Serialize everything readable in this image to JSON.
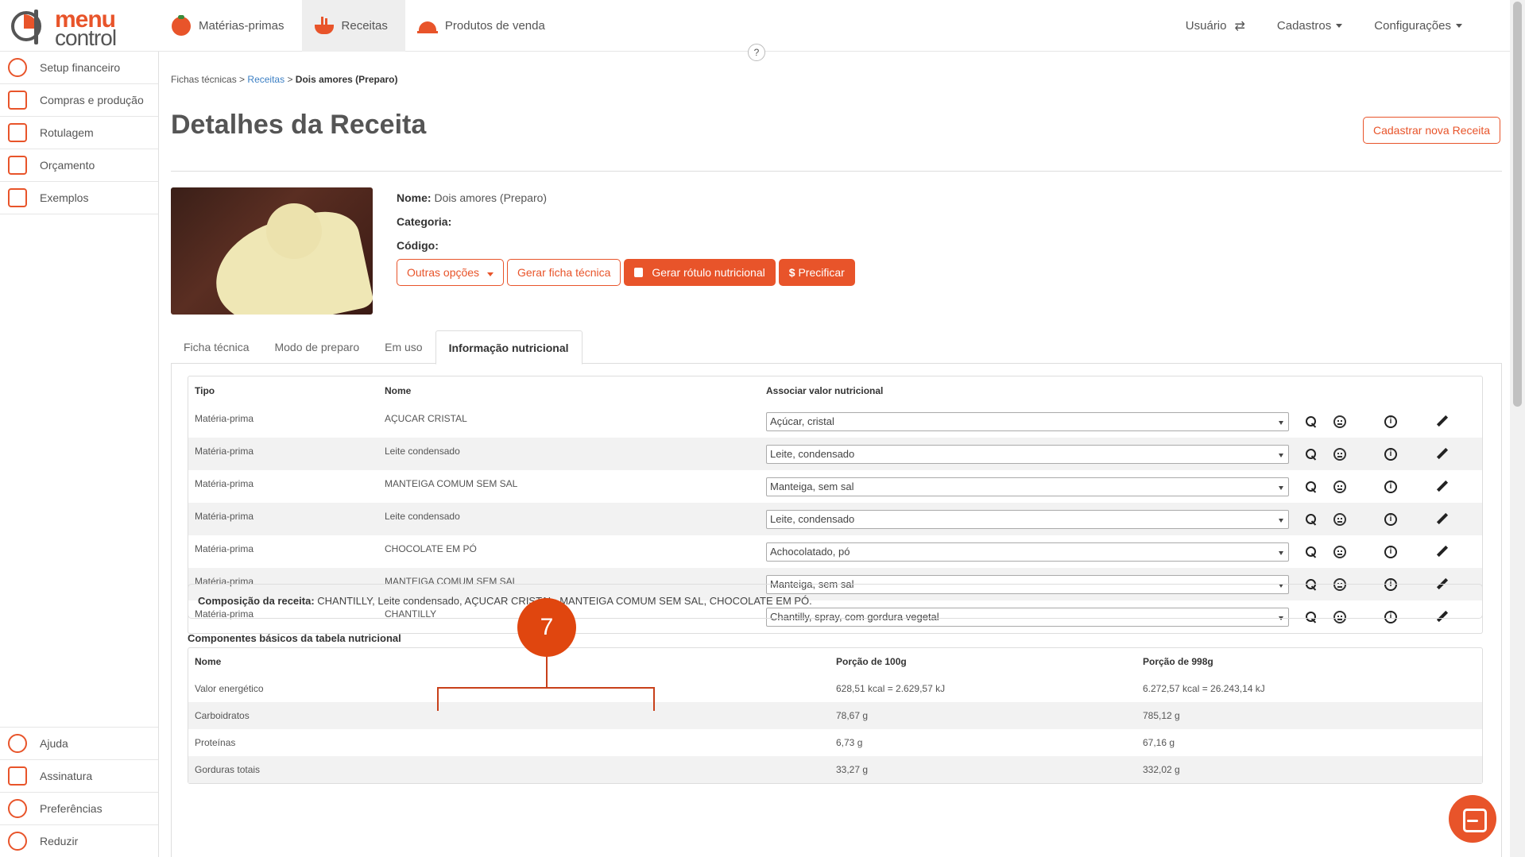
{
  "logo": {
    "word1": "menu",
    "word2": "control"
  },
  "nav": [
    {
      "label": "Matérias-primas",
      "icon": "tomato-icon"
    },
    {
      "label": "Receitas",
      "icon": "pot-icon"
    },
    {
      "label": "Produtos de venda",
      "icon": "cloche-icon"
    }
  ],
  "user_nav": {
    "usuario": "Usuário",
    "cadastros": "Cadastros",
    "configuracoes": "Configurações",
    "help": "?"
  },
  "sidebar": {
    "items": [
      {
        "label": "Setup financeiro",
        "icon": "gear-dollar-icon"
      },
      {
        "label": "Compras e produção",
        "icon": "cart-icon"
      },
      {
        "label": "Rotulagem",
        "icon": "label-icon"
      },
      {
        "label": "Orçamento",
        "icon": "budget-icon"
      },
      {
        "label": "Exemplos",
        "icon": "examples-icon"
      }
    ],
    "bottom": [
      {
        "label": "Ajuda",
        "icon": "help-icon"
      },
      {
        "label": "Assinatura",
        "icon": "card-icon"
      },
      {
        "label": "Preferências",
        "icon": "gear-icon"
      },
      {
        "label": "Reduzir",
        "icon": "collapse-icon"
      }
    ]
  },
  "breadcrumb": {
    "part1": "Fichas técnicas",
    "sep": ">",
    "part2": "Receitas",
    "current": "Dois amores (Preparo)"
  },
  "page": {
    "title": "Detalhes da Receita",
    "new_button": "Cadastrar nova Receita"
  },
  "recipe": {
    "nome_label": "Nome:",
    "nome": "Dois amores (Preparo)",
    "categoria_label": "Categoria:",
    "categoria": "",
    "codigo_label": "Código:",
    "codigo": ""
  },
  "actions": {
    "outras": "Outras opções",
    "gerar_ficha": "Gerar ficha técnica",
    "gerar_rotulo": "Gerar rótulo nutricional",
    "precificar": "Precificar"
  },
  "tabs": [
    "Ficha técnica",
    "Modo de preparo",
    "Em uso",
    "Informação nutricional"
  ],
  "ingredients": {
    "headers": {
      "tipo": "Tipo",
      "nome": "Nome",
      "associar": "Associar valor nutricional"
    },
    "rows": [
      {
        "tipo": "Matéria-prima",
        "nome": "AÇUCAR CRISTAL",
        "assoc": "Açúcar, cristal"
      },
      {
        "tipo": "Matéria-prima",
        "nome": "Leite condensado",
        "assoc": "Leite, condensado"
      },
      {
        "tipo": "Matéria-prima",
        "nome": "MANTEIGA COMUM SEM SAL",
        "assoc": "Manteiga, sem sal"
      },
      {
        "tipo": "Matéria-prima",
        "nome": "Leite condensado",
        "assoc": "Leite, condensado"
      },
      {
        "tipo": "Matéria-prima",
        "nome": "CHOCOLATE EM PÓ",
        "assoc": "Achocolatado, pó"
      },
      {
        "tipo": "Matéria-prima",
        "nome": "MANTEIGA COMUM SEM SAL",
        "assoc": "Manteiga, sem sal"
      },
      {
        "tipo": "Matéria-prima",
        "nome": "CHANTILLY",
        "assoc": "Chantilly, spray, com gordura vegetal"
      }
    ]
  },
  "composition": {
    "label": "Composição da receita:",
    "text": "CHANTILLY, Leite condensado, AÇUCAR CRISTAL, MANTEIGA COMUM SEM SAL, CHOCOLATE EM PÓ."
  },
  "nutrition": {
    "title": "Componentes básicos da tabela nutricional",
    "headers": {
      "nome": "Nome",
      "p100": "Porção de 100g",
      "p998": "Porção de 998g"
    },
    "rows": [
      {
        "nome": "Valor energético",
        "p100": "628,51 kcal = 2.629,57 kJ",
        "p998": "6.272,57 kcal = 26.243,14 kJ"
      },
      {
        "nome": "Carboidratos",
        "p100": "78,67 g",
        "p998": "785,12 g"
      },
      {
        "nome": "Proteínas",
        "p100": "6,73 g",
        "p998": "67,16 g"
      },
      {
        "nome": "Gorduras totais",
        "p100": "33,27 g",
        "p998": "332,02 g"
      }
    ]
  },
  "callout": {
    "number": "7"
  },
  "colors": {
    "accent": "#e8542a",
    "link": "#3b7fc4"
  }
}
